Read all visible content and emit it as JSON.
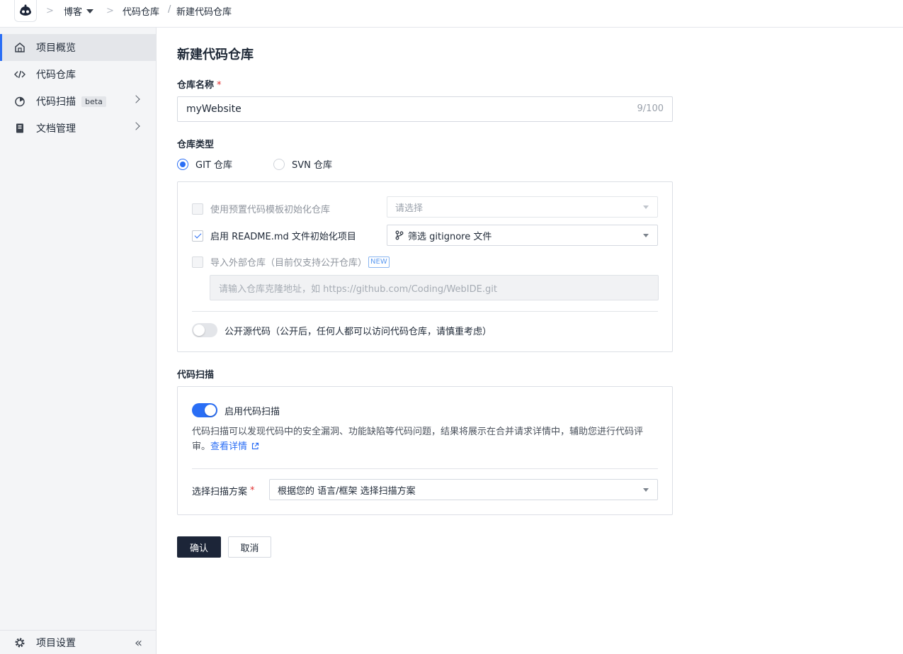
{
  "breadcrumb": {
    "project": "博客",
    "section": "代码仓库",
    "current": "新建代码仓库",
    "separator": "/"
  },
  "sidebar": {
    "items": [
      {
        "label": "项目概览",
        "icon": "home-icon",
        "active": true
      },
      {
        "label": "代码仓库",
        "icon": "code-icon",
        "active": false
      },
      {
        "label": "代码扫描",
        "icon": "scan-icon",
        "badge": "beta",
        "active": false
      },
      {
        "label": "文档管理",
        "icon": "document-icon",
        "active": false
      }
    ],
    "bottom": {
      "label": "项目设置",
      "icon": "gear-icon",
      "collapse": "«"
    }
  },
  "page": {
    "title": "新建代码仓库",
    "repo_name": {
      "label": "仓库名称",
      "required": "*",
      "value": "myWebsite",
      "counter": "9/100"
    },
    "repo_type": {
      "label": "仓库类型",
      "options": [
        {
          "label": "GIT 仓库",
          "selected": true
        },
        {
          "label": "SVN 仓库",
          "selected": false
        }
      ]
    },
    "init": {
      "template": {
        "label": "使用预置代码模板初始化仓库",
        "checked": false,
        "select_placeholder": "请选择"
      },
      "readme": {
        "label": "启用 README.md 文件初始化项目",
        "checked": true,
        "select_value": "筛选 gitignore 文件"
      },
      "import": {
        "label": "导入外部仓库（目前仅支持公开仓库）",
        "badge": "NEW",
        "checked": false,
        "placeholder": "请输入仓库克隆地址，如 https://github.com/Coding/WebIDE.git"
      },
      "public": {
        "label": "公开源代码（公开后，任何人都可以访问代码仓库，请慎重考虑）",
        "on": false
      }
    },
    "scan": {
      "section_label": "代码扫描",
      "toggle_label": "启用代码扫描",
      "on": true,
      "description": "代码扫描可以发现代码中的安全漏洞、功能缺陷等代码问题，结果将展示在合并请求详情中，辅助您进行代码评审。",
      "link": "查看详情",
      "plan_label": "选择扫描方案",
      "plan_required": "*",
      "plan_value": "根据您的 语言/框架 选择扫描方案"
    },
    "buttons": {
      "confirm": "确认",
      "cancel": "取消"
    }
  },
  "colors": {
    "accent": "#2a6ef5",
    "primary_button": "#1c2538",
    "required": "#e02d2d"
  }
}
